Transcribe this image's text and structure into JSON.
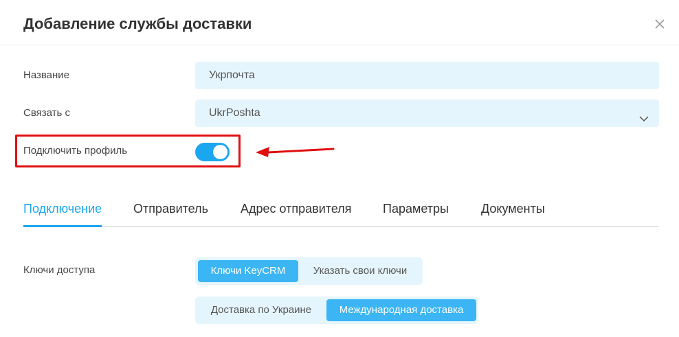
{
  "dialog": {
    "title": "Добавление службы доставки"
  },
  "form": {
    "name_label": "Название",
    "name_value": "Укрпочта",
    "link_label": "Связать с",
    "link_value": "UkrPoshta",
    "profile_label": "Подключить профиль",
    "profile_enabled": true
  },
  "tabs": [
    {
      "label": "Подключение",
      "active": true
    },
    {
      "label": "Отправитель",
      "active": false
    },
    {
      "label": "Адрес отправителя",
      "active": false
    },
    {
      "label": "Параметры",
      "active": false
    },
    {
      "label": "Документы",
      "active": false
    }
  ],
  "access": {
    "label": "Ключи доступа",
    "key_options": [
      {
        "label": "Ключи KeyCRM",
        "selected": true
      },
      {
        "label": "Указать свои ключи",
        "selected": false
      }
    ],
    "delivery_options": [
      {
        "label": "Доставка по Украине",
        "selected": false
      },
      {
        "label": "Международная доставка",
        "selected": true
      }
    ]
  },
  "colors": {
    "accent": "#1aa7f0",
    "highlight": "#e01010",
    "input_bg": "#e5f5fd"
  }
}
